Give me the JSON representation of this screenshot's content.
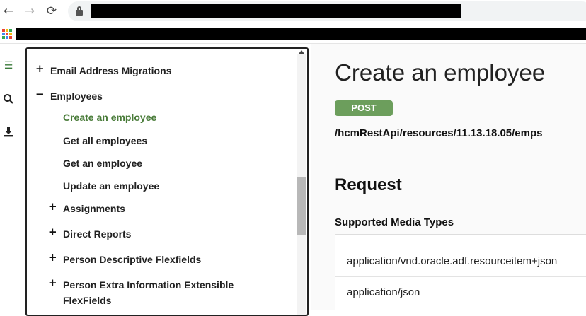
{
  "browser": {
    "back_icon": "arrow-left-icon",
    "forward_icon": "arrow-right-icon",
    "reload_icon": "reload-icon",
    "lock_icon": "lock-icon",
    "apps_icon": "apps-grid-icon",
    "apps_colors": [
      "#ea4335",
      "#fbbc05",
      "#34a853",
      "#4285f4",
      "#ea4335",
      "#fbbc05",
      "#34a853",
      "#4285f4",
      "#ea4335"
    ]
  },
  "side_rail": {
    "items": [
      {
        "icon": "list-icon"
      },
      {
        "icon": "search-icon"
      },
      {
        "icon": "download-icon"
      }
    ]
  },
  "toc": {
    "cut_label": "",
    "items": [
      {
        "sign": "+",
        "label": "Email Address Migrations"
      },
      {
        "sign": "−",
        "label": "Employees"
      },
      {
        "sign": "",
        "label": "Create an employee",
        "active": true
      },
      {
        "sign": "",
        "label": "Get all employees"
      },
      {
        "sign": "",
        "label": "Get an employee"
      },
      {
        "sign": "",
        "label": "Update an employee"
      },
      {
        "sign": "+",
        "label": "Assignments"
      },
      {
        "sign": "+",
        "label": "Direct Reports"
      },
      {
        "sign": "+",
        "label": "Person Descriptive Flexfields"
      },
      {
        "sign": "+",
        "label": "Person Extra Information Extensible",
        "label2": "FlexFields"
      }
    ]
  },
  "content": {
    "title": "Create an employee",
    "method": "POST",
    "method_color": "#6c9e5c",
    "endpoint": "/hcmRestApi/resources/11.13.18.05/emps",
    "section_title": "Request",
    "media_types_label": "Supported Media Types",
    "media_types": [
      "application/vnd.oracle.adf.resourceitem+json",
      "application/json"
    ]
  }
}
